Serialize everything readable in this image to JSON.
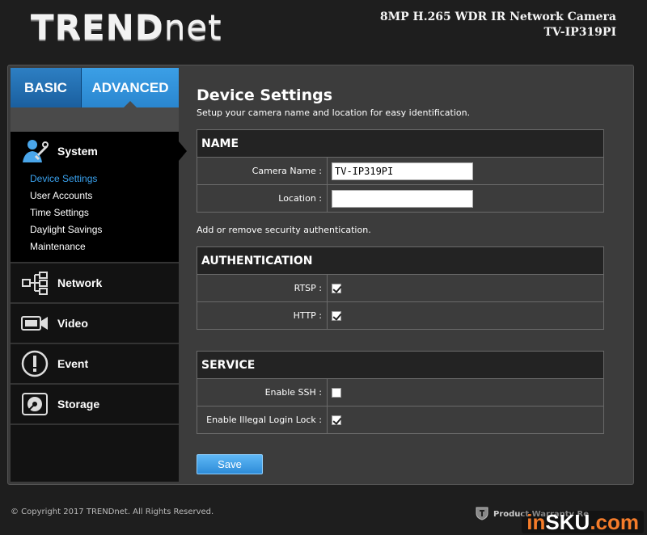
{
  "header": {
    "logo_main": "TREND",
    "logo_net": "net",
    "product_line1": "8MP H.265 WDR IR Network Camera",
    "product_line2": "TV-IP319PI"
  },
  "tabs": {
    "basic": "BASIC",
    "advanced": "ADVANCED"
  },
  "sidebar": {
    "system": {
      "label": "System",
      "items": [
        {
          "label": "Device Settings",
          "active": true
        },
        {
          "label": "User Accounts"
        },
        {
          "label": "Time Settings"
        },
        {
          "label": "Daylight Savings"
        },
        {
          "label": "Maintenance"
        }
      ]
    },
    "network": {
      "label": "Network"
    },
    "video": {
      "label": "Video"
    },
    "event": {
      "label": "Event"
    },
    "storage": {
      "label": "Storage"
    }
  },
  "content": {
    "title": "Device Settings",
    "description": "Setup your camera name and location for easy identification.",
    "name_section": {
      "header": "NAME",
      "camera_name_label": "Camera Name :",
      "camera_name_value": "TV-IP319PI",
      "location_label": "Location :",
      "location_value": ""
    },
    "auth_note": "Add or remove security authentication.",
    "auth_section": {
      "header": "AUTHENTICATION",
      "rtsp_label": "RTSP :",
      "rtsp_checked": true,
      "http_label": "HTTP :",
      "http_checked": true
    },
    "service_section": {
      "header": "SERVICE",
      "ssh_label": "Enable SSH :",
      "ssh_checked": false,
      "illegal_login_label": "Enable Illegal Login Lock :",
      "illegal_login_checked": true
    },
    "save_label": "Save"
  },
  "footer": {
    "copyright": "© Copyright 2017 TRENDnet. All Rights Reserved.",
    "warranty": "Product Warranty Re"
  },
  "watermark": {
    "part1": "in",
    "part2": "SKU",
    "part3": ".com"
  },
  "colors": {
    "accent_blue": "#2a86cf",
    "active_link": "#3aa3f0",
    "panel_bg": "#3c3c3c"
  }
}
